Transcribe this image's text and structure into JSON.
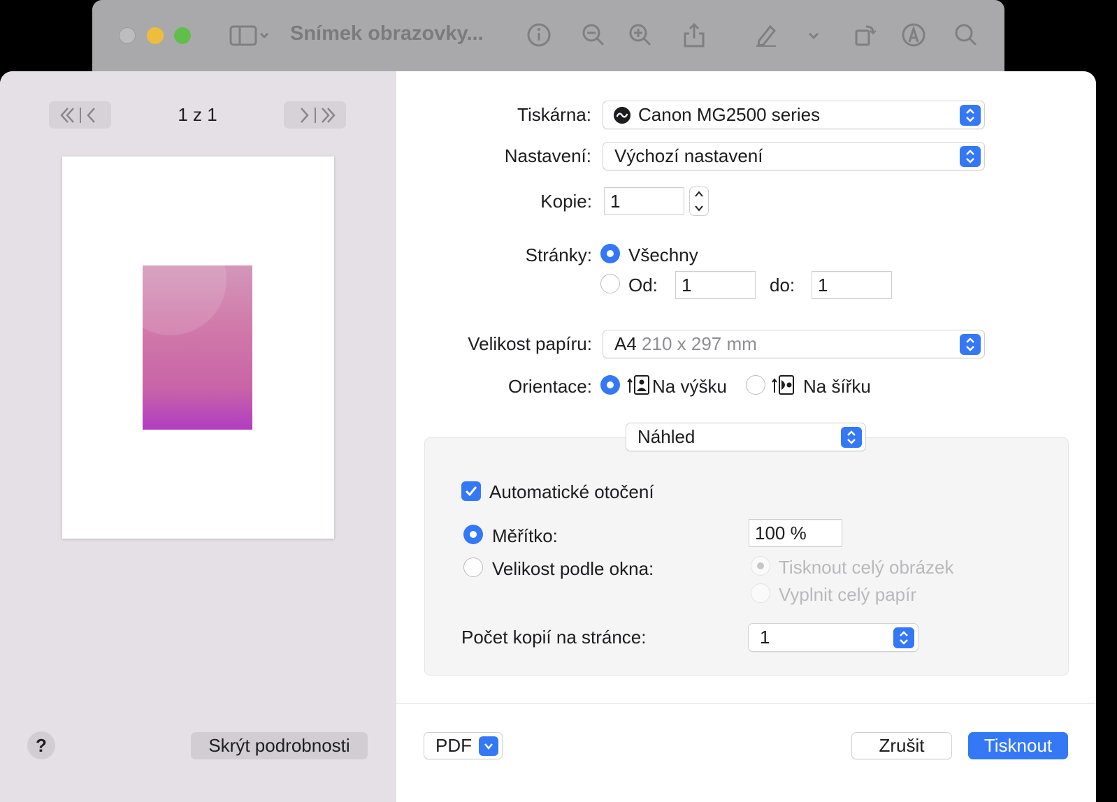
{
  "background_window": {
    "title": "Snímek obrazovky..."
  },
  "preview": {
    "page_counter": "1 z 1",
    "help_label": "?",
    "hide_details_label": "Skrýt podrobnosti"
  },
  "form": {
    "printer_label": "Tiskárna:",
    "printer_value": "Canon MG2500 series",
    "presets_label": "Nastavení:",
    "presets_value": "Výchozí nastavení",
    "copies_label": "Kopie:",
    "copies_value": "1",
    "pages_label": "Stránky:",
    "pages_all_label": "Všechny",
    "pages_from_label": "Od:",
    "pages_from_value": "1",
    "pages_to_label": "do:",
    "pages_to_value": "1",
    "paper_size_label": "Velikost papíru:",
    "paper_size_name": "A4",
    "paper_size_dims": "210 x 297 mm",
    "orientation_label": "Orientace:",
    "orientation_portrait": "Na výšku",
    "orientation_landscape": "Na šířku",
    "section_select": "Náhled",
    "auto_rotate_label": "Automatické otočení",
    "scale_label": "Měřítko:",
    "scale_value": "100 %",
    "fit_label": "Velikost podle okna:",
    "fit_print_entire": "Tisknout celý obrázek",
    "fit_fill_paper": "Vyplnit celý papír",
    "copies_per_page_label": "Počet kopií na stránce:",
    "copies_per_page_value": "1"
  },
  "footer": {
    "pdf_label": "PDF",
    "cancel_label": "Zrušit",
    "print_label": "Tisknout"
  },
  "colors": {
    "accent": "#3478f6",
    "sidebar_bg": "#e5e0e6"
  }
}
